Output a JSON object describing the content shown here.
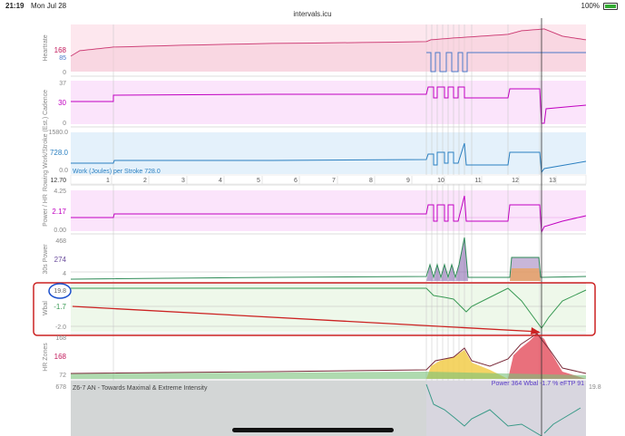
{
  "status": {
    "time": "21:19",
    "date": "Mon Jul 28",
    "url": "intervals.icu",
    "battery": "100%"
  },
  "panels": {
    "heartrate": {
      "label": "Heartrate",
      "ticks": [
        "168",
        "85",
        "0"
      ]
    },
    "cadence": {
      "label": "Cadence",
      "ticks": [
        "37",
        "30",
        "0"
      ]
    },
    "work": {
      "label": "Rowing Work/Stroke (Est.)",
      "ticks": [
        "1580.0",
        "728.0",
        "0.0"
      ],
      "legend": "Work (Joules) per Stroke 728.0"
    },
    "power_hr": {
      "label": "Power / HR",
      "ticks": [
        "4.25",
        "2.17",
        "0.00"
      ]
    },
    "power30": {
      "label": "30s Power",
      "ticks": [
        "468",
        "274",
        "4"
      ]
    },
    "wbal": {
      "label": "Wbal",
      "ticks": [
        "19.8",
        "-1.7",
        "-2.0"
      ]
    },
    "hrzones": {
      "label": "HR Zones",
      "ticks": [
        "168",
        "168",
        "72"
      ]
    },
    "zone": {
      "label": "678",
      "title": "Z6-7 AN - Towards Maximal & Extreme Intensity",
      "right_tick": "19.8"
    }
  },
  "xaxis": {
    "start": "12.70",
    "ticks": [
      "1",
      "2",
      "3",
      "4",
      "5",
      "6",
      "7",
      "8",
      "9",
      "10",
      "11",
      "12",
      "13"
    ]
  },
  "readout": "Power 364  Wbal -1.7  % eFTP 91",
  "colors": {
    "hr": "#c2185b",
    "cadence": "#c000c0",
    "work": "#2a7fc0",
    "power": "#2e8b57",
    "wbal": "#3a9a55",
    "annot": "#cc2222",
    "circle": "#1a4fcc"
  }
}
